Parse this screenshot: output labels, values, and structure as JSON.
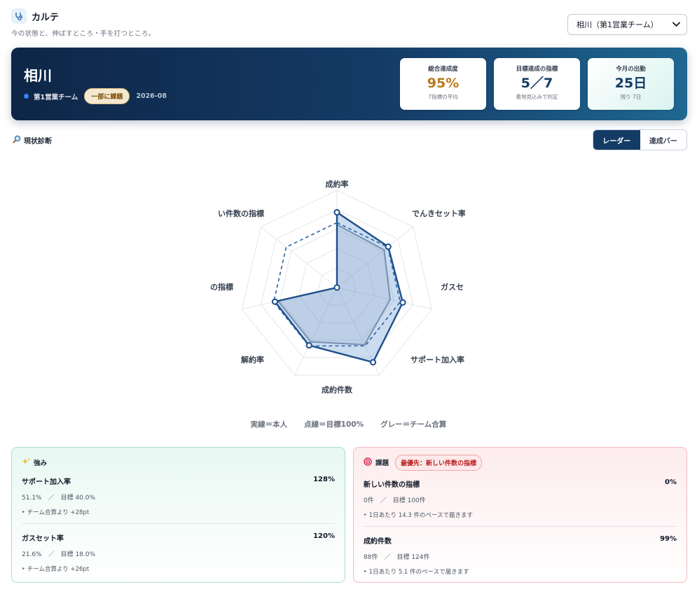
{
  "app": {
    "title": "カルテ",
    "subtitle": "今の状態と、伸ばすところ・手を打つところ。",
    "logo_icon": "stethoscope-icon"
  },
  "member_select": {
    "value": "相川（第1営業チーム）"
  },
  "hero": {
    "name": "相川",
    "team": "第1営業チーム",
    "status": "一部に課題",
    "period": "2026-08",
    "kpis": [
      {
        "label": "総合達成度",
        "value": "95%",
        "note": "7指標の平均",
        "color": "#b7791f"
      },
      {
        "label": "目標達成の指標",
        "value": "5／7",
        "note": "着地見込みで判定",
        "color": "#143b66"
      },
      {
        "label": "今月の出勤",
        "value": "25日",
        "note": "残り 7日",
        "color": "#143b66"
      }
    ]
  },
  "section": {
    "title": "現状診断",
    "icon": "magnifier-icon"
  },
  "view_toggle": {
    "radar": "レーダー",
    "bar": "達成バー",
    "active": "radar"
  },
  "chart_data": {
    "type": "radar",
    "axes": [
      "成約率",
      "でんきセット率",
      "ガスセット率",
      "サポート加入率",
      "成約件数",
      "解約率",
      "新しい件数の指標"
    ],
    "visible_labels": [
      "成約率",
      "でんきセット率",
      "ガスセ",
      "サポート加入率",
      "成約件数",
      "解約率",
      "の指標",
      "い件数の指標"
    ],
    "max_percent": 150,
    "target_percent": 100,
    "series": [
      {
        "name": "本人",
        "values": [
          116,
          101,
          104,
          128,
          99,
          98,
          0
        ]
      },
      {
        "name": "チーム合算",
        "values": [
          97,
          93,
          84,
          98,
          93,
          93,
          0
        ]
      }
    ],
    "colors": {
      "self": "#1d4f8b",
      "team": "#8a96a8",
      "target": "#2a63a6"
    }
  },
  "legend": {
    "self": "実線＝本人",
    "target": "点線＝目標100%",
    "team": "グレー＝チーム合算"
  },
  "strengths": {
    "title": "強み",
    "icon": "sparkles-icon",
    "items": [
      {
        "name": "サポート加入率",
        "pct": "128%",
        "detail": "51.1%　／　目標 40.0%",
        "note": "‣ チーム合算より +28pt"
      },
      {
        "name": "ガスセット率",
        "pct": "120%",
        "detail": "21.6%　／　目標 18.0%",
        "note": "‣ チーム合算より +26pt"
      }
    ]
  },
  "issues": {
    "title": "課題",
    "icon": "target-icon",
    "priority": "最優先：新しい件数の指標",
    "items": [
      {
        "name": "新しい件数の指標",
        "pct": "0%",
        "detail": "0件　／　目標 100件",
        "note": "‣ 1日あたり 14.3 件のペースで届きます"
      },
      {
        "name": "成約件数",
        "pct": "99%",
        "detail": "88件　／　目標 124件",
        "note": "‣ 1日あたり 5.1 件のペースで届きます"
      }
    ]
  }
}
